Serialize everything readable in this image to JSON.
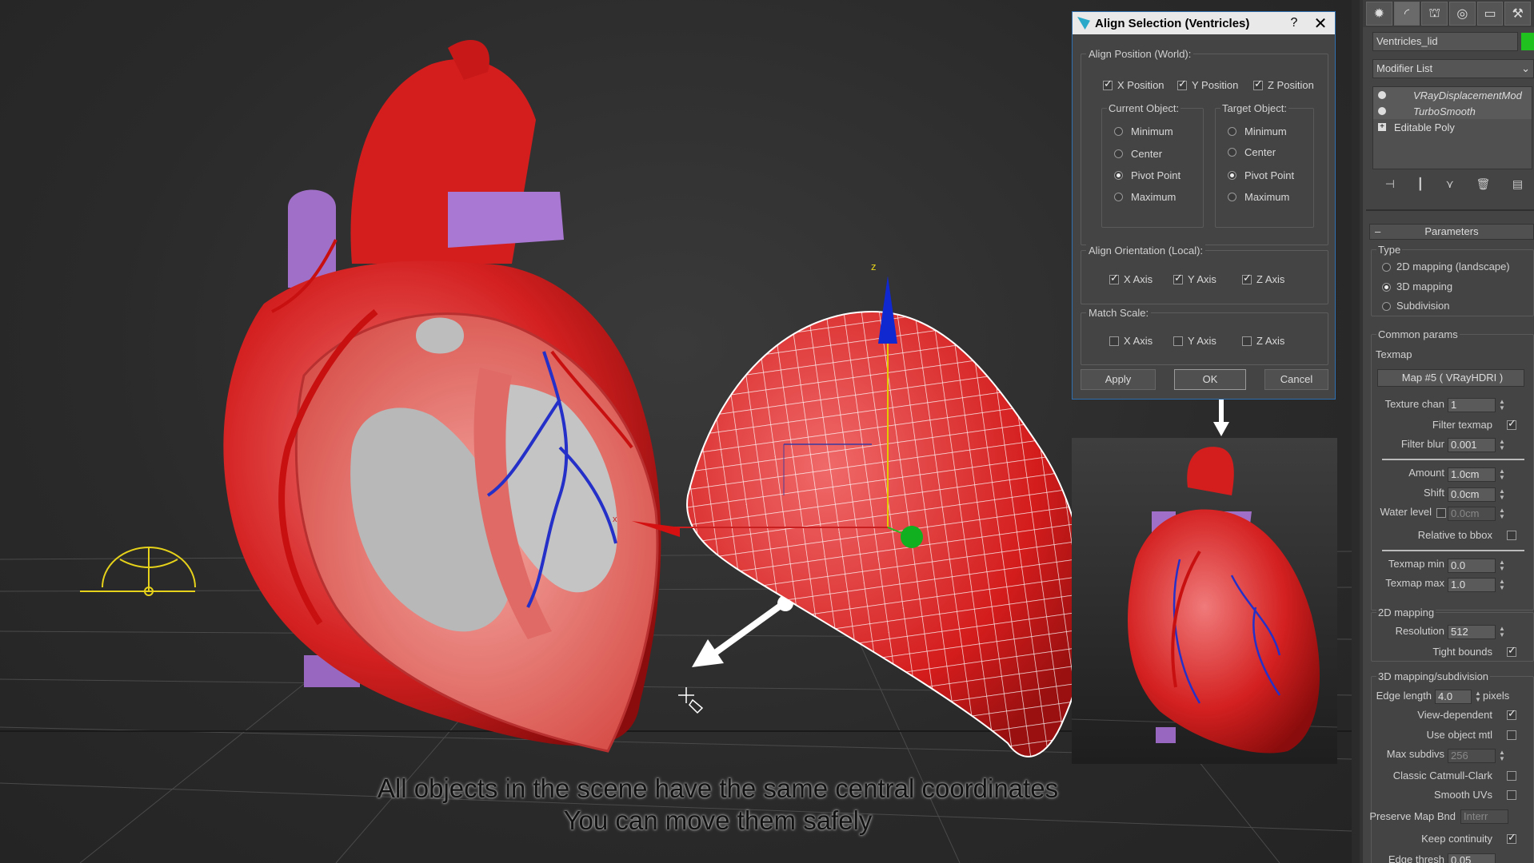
{
  "caption": {
    "line1": "All objects in the scene have the same central coordinates",
    "line2": "You can move them safely"
  },
  "gizmo": {
    "axis_z": "z",
    "axis_x": "x"
  },
  "align_dialog": {
    "title": "Align Selection (Ventricles)",
    "help": "?",
    "close": "✕",
    "position_group": "Align Position (World):",
    "x_position": {
      "label": "X Position",
      "checked": true
    },
    "y_position": {
      "label": "Y Position",
      "checked": true
    },
    "z_position": {
      "label": "Z Position",
      "checked": true
    },
    "current_object": {
      "label": "Current Object:",
      "options": [
        "Minimum",
        "Center",
        "Pivot Point",
        "Maximum"
      ],
      "selected": "Pivot Point"
    },
    "target_object": {
      "label": "Target Object:",
      "options": [
        "Minimum",
        "Center",
        "Pivot Point",
        "Maximum"
      ],
      "selected": "Pivot Point"
    },
    "orientation_group": "Align Orientation (Local):",
    "orient_x": {
      "label": "X Axis",
      "checked": true
    },
    "orient_y": {
      "label": "Y Axis",
      "checked": true
    },
    "orient_z": {
      "label": "Z Axis",
      "checked": true
    },
    "scale_group": "Match Scale:",
    "scale_x": {
      "label": "X Axis",
      "checked": false
    },
    "scale_y": {
      "label": "Y Axis",
      "checked": false
    },
    "scale_z": {
      "label": "Z Axis",
      "checked": false
    },
    "apply": "Apply",
    "ok": "OK",
    "cancel": "Cancel"
  },
  "command_panel": {
    "object_name": "Ventricles_lid",
    "object_color": "#1fc21f",
    "modifier_list": "Modifier List",
    "modifiers": [
      "VRayDisplacementMod",
      "TurboSmooth",
      "Editable Poly"
    ],
    "rollout_title": "Parameters",
    "minus": "–",
    "type_label": "Type",
    "type_options": [
      "2D mapping (landscape)",
      "3D mapping",
      "Subdivision"
    ],
    "type_selected": "3D mapping",
    "common_params": "Common params",
    "texmap_label": "Texmap",
    "texmap_button": "Map #5  ( VRayHDRI )",
    "texture_chan": {
      "label": "Texture chan",
      "value": "1"
    },
    "filter_texmap": {
      "label": "Filter texmap",
      "checked": true
    },
    "filter_blur": {
      "label": "Filter blur",
      "value": "0.001"
    },
    "amount": {
      "label": "Amount",
      "value": "1.0cm"
    },
    "shift": {
      "label": "Shift",
      "value": "0.0cm"
    },
    "water_level": {
      "label": "Water level",
      "value": "0.0cm",
      "checked": false
    },
    "relative_bbox": {
      "label": "Relative to bbox",
      "checked": false
    },
    "texmap_min": {
      "label": "Texmap min",
      "value": "0.0"
    },
    "texmap_max": {
      "label": "Texmap max",
      "value": "1.0"
    },
    "mapping_2d": "2D mapping",
    "resolution": {
      "label": "Resolution",
      "value": "512"
    },
    "tight_bounds": {
      "label": "Tight bounds",
      "checked": true
    },
    "mapping_3d": "3D mapping/subdivision",
    "edge_length": {
      "label": "Edge length",
      "value": "4.0",
      "unit": "pixels"
    },
    "view_dependent": {
      "label": "View-dependent",
      "checked": true
    },
    "use_object_mtl": {
      "label": "Use object mtl",
      "checked": false
    },
    "max_subdivs": {
      "label": "Max subdivs",
      "value": "256"
    },
    "classic_catmull": {
      "label": "Classic Catmull-Clark",
      "checked": false
    },
    "smooth_uvs": {
      "label": "Smooth UVs",
      "checked": false
    },
    "preserve_map": {
      "label": "Preserve Map Bnd",
      "value": "Interr"
    },
    "keep_continuity": {
      "label": "Keep continuity",
      "checked": true
    },
    "edge_thresh": {
      "label": "Edge thresh",
      "value": "0.05"
    }
  },
  "colors": {
    "heart_red": "#d42020",
    "vessel_purple": "#a070c8",
    "gizmo_blue": "#1028d0",
    "gizmo_green": "#10b020",
    "light_yellow": "#e6d21a",
    "dialog_border": "#2f6fb0"
  }
}
